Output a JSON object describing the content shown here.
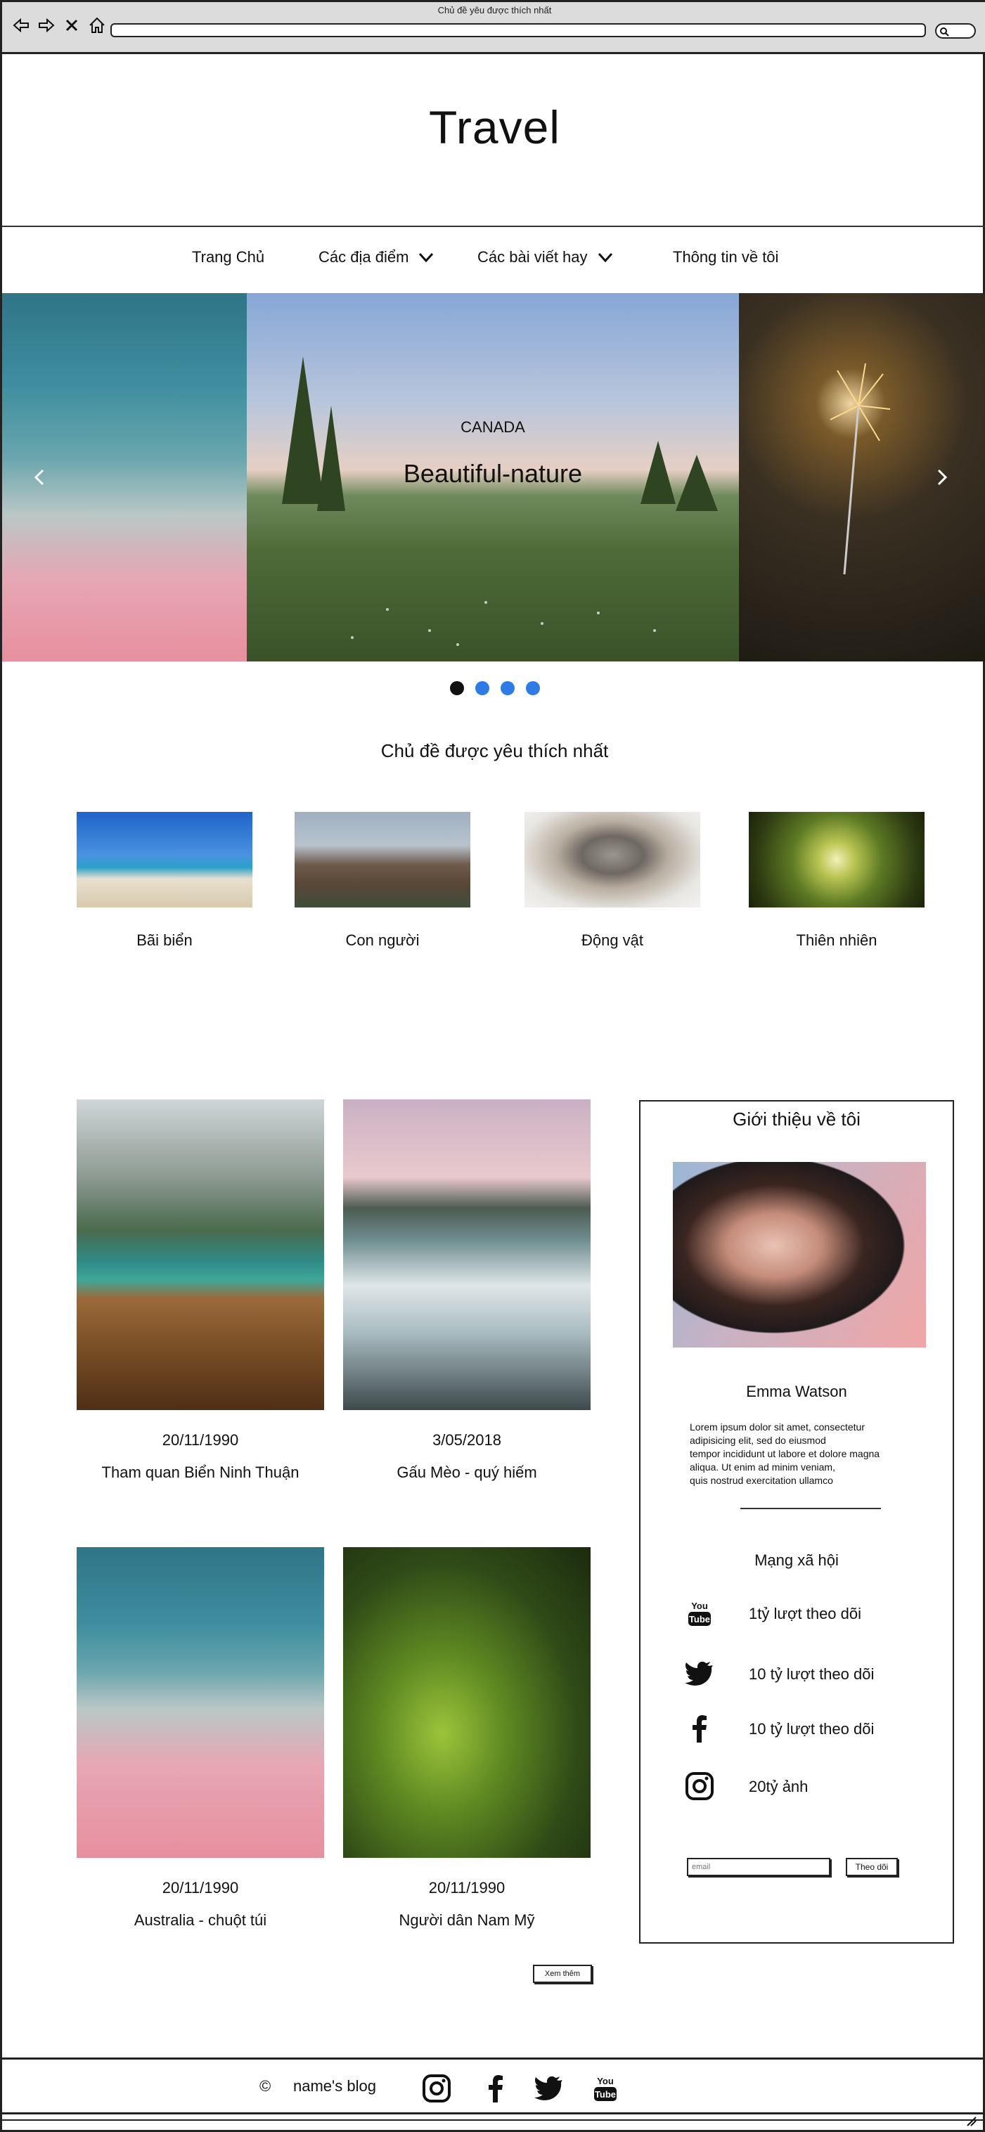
{
  "browser": {
    "title": "Chủ đề yêu được thích nhất"
  },
  "header": {
    "site_title": "Travel"
  },
  "menu": {
    "items": [
      {
        "label": "Trang Chủ",
        "has_dropdown": false
      },
      {
        "label": "Các địa điểm",
        "has_dropdown": true
      },
      {
        "label": "Các bài viết hay",
        "has_dropdown": true
      },
      {
        "label": "Thông tin về tôi",
        "has_dropdown": false
      }
    ]
  },
  "slider": {
    "caption_small": "CANADA",
    "caption_big": "Beautiful-nature",
    "slide_count": 4,
    "active_index": 0
  },
  "topics": {
    "title": "Chủ đề được yêu thích nhất",
    "items": [
      {
        "label": "Bãi biển"
      },
      {
        "label": "Con người"
      },
      {
        "label": "Động vật"
      },
      {
        "label": "Thiên nhiên"
      }
    ]
  },
  "posts": [
    {
      "date": "20/11/1990",
      "title": "Tham quan Biển Ninh Thuận"
    },
    {
      "date": "3/05/2018",
      "title": "Gấu Mèo - quý hiếm"
    },
    {
      "date": "20/11/1990",
      "title": "Australia - chuột túi"
    },
    {
      "date": "20/11/1990",
      "title": "Người dân Nam Mỹ"
    }
  ],
  "more_button": {
    "label": "Xem thêm"
  },
  "sidebar": {
    "title": "Giới thiệu về tôi",
    "name": "Emma Watson",
    "bio_lines": [
      "Lorem ipsum dolor sit amet, consectetur",
      "adipisicing elit, sed do eiusmod",
      "tempor incididunt ut labore et dolore magna",
      "aliqua. Ut enim ad minim veniam,",
      "quis nostrud exercitation ullamco"
    ],
    "social_title": "Mạng xã hội",
    "social": [
      {
        "icon": "youtube-icon",
        "text": "1tỷ lượt theo dõi"
      },
      {
        "icon": "twitter-icon",
        "text": "10 tỷ lượt theo dõi"
      },
      {
        "icon": "facebook-icon",
        "text": "10 tỷ lượt theo dõi"
      },
      {
        "icon": "instagram-icon",
        "text": "20tỷ ảnh"
      }
    ],
    "email_placeholder": "email",
    "follow_label": "Theo dõi"
  },
  "footer": {
    "copyright_symbol": "©",
    "blog_name": "name's blog"
  }
}
